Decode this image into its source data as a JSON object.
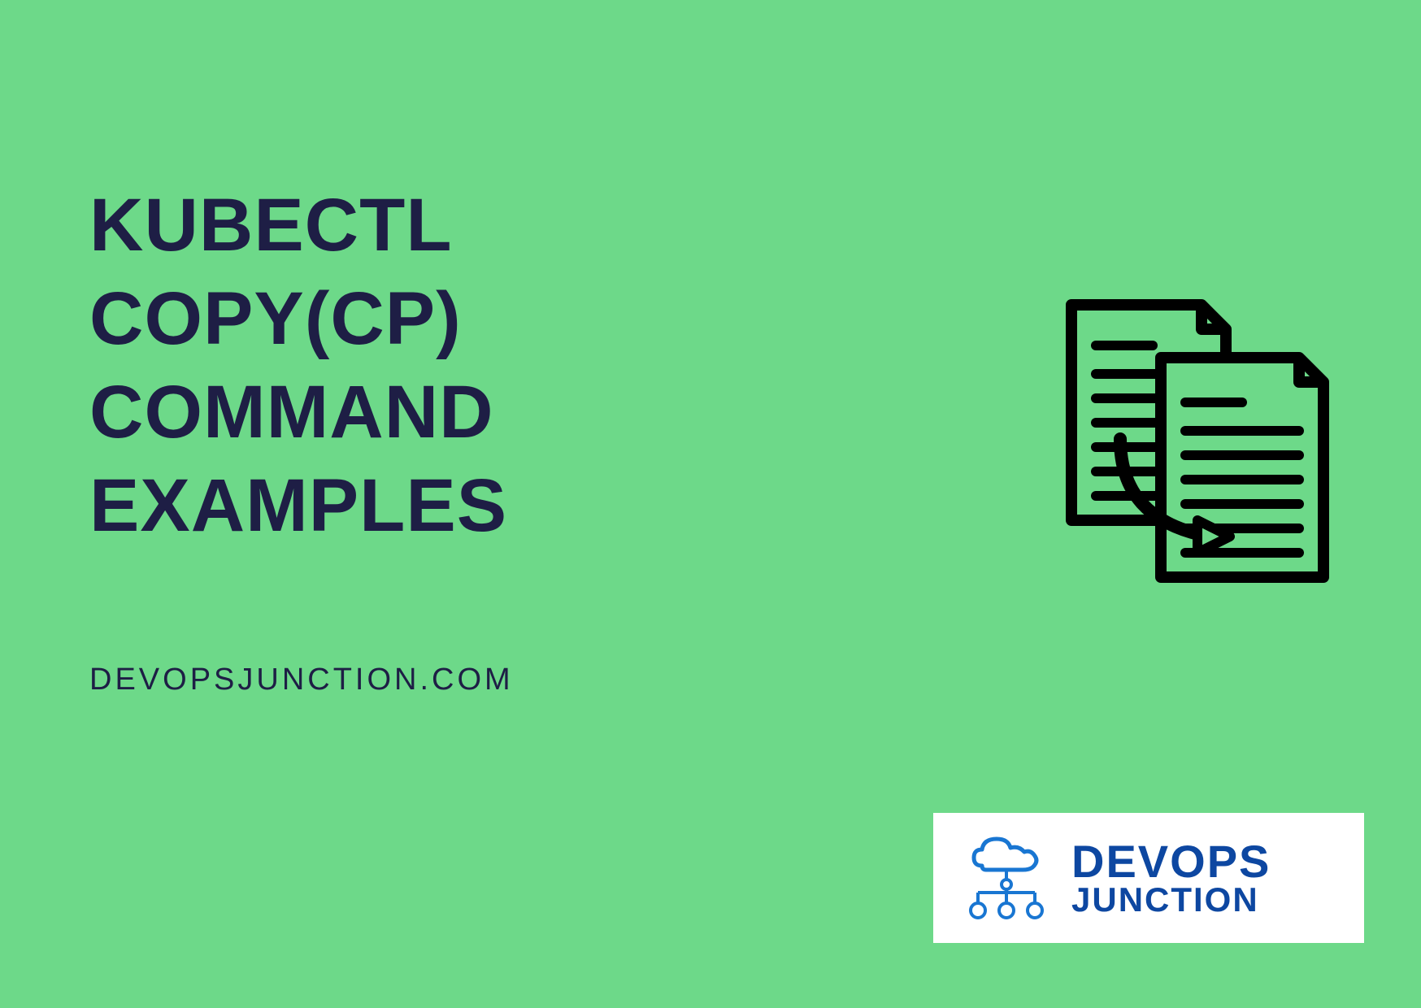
{
  "title": {
    "line1": "KUBECTL COPY(CP)",
    "line2": "COMMAND",
    "line3": "EXAMPLES"
  },
  "website": "DEVOPSJUNCTION.COM",
  "logo": {
    "line1": "DEVOPS",
    "line2": "JUNCTION"
  },
  "colors": {
    "background": "#6dd989",
    "text_dark": "#1e1e45",
    "logo_blue": "#0d47a1",
    "logo_bg": "#ffffff"
  }
}
